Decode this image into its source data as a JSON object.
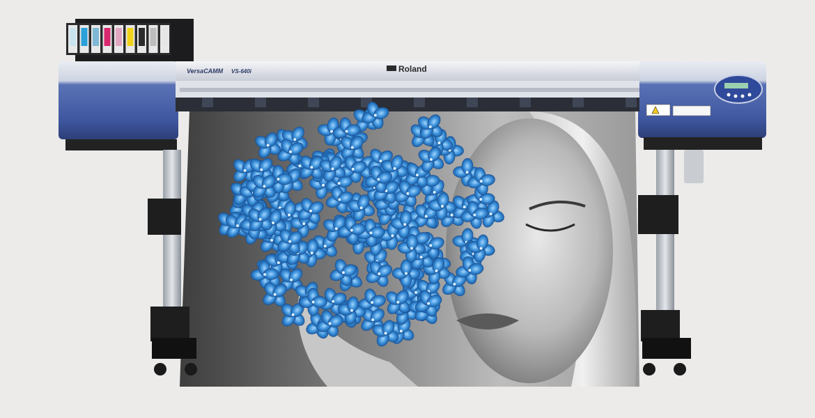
{
  "product": {
    "brand_logo": "Roland",
    "series_logo": "VersaCAMM",
    "model_label": "VS-640i"
  },
  "colors": {
    "background": "#ecebea",
    "chassis_blue": "#4a63a8",
    "chassis_light": "#d9dde6",
    "flower_blue": "#3a8fd8",
    "print_gray": "#6f6f6f"
  },
  "ink_cartridges": [
    {
      "color": "#c9e4ee"
    },
    {
      "color": "#2aa1d9"
    },
    {
      "color": "#7fb8d4"
    },
    {
      "color": "#d9286d"
    },
    {
      "color": "#e0a6c2"
    },
    {
      "color": "#f2d31b"
    },
    {
      "color": "#2b2b2b"
    },
    {
      "color": "#bdbdbd"
    },
    {
      "color": "#e6e6e6"
    }
  ],
  "icons": {
    "control_panel": "control-panel-icon",
    "warning_labels": "warning-label-icon"
  }
}
